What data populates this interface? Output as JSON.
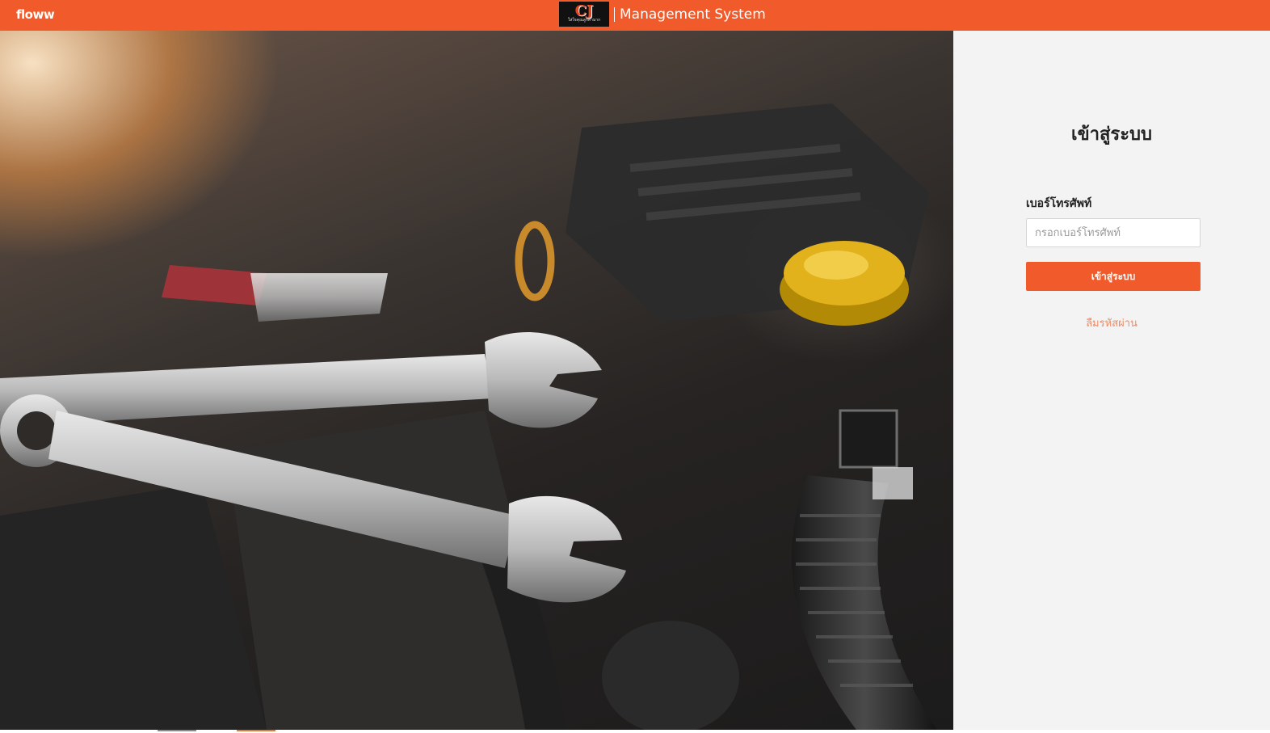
{
  "header": {
    "brand": "floww",
    "logo_text": "CJ",
    "logo_subtext": "ใส่ใจคุณลูกค้ามาก",
    "system_title": "Management System"
  },
  "hero": {
    "image_subject": "car-engine-with-wrenches"
  },
  "login": {
    "title": "เข้าสู่ระบบ",
    "phone_label": "เบอร์โทรศัพท์",
    "phone_placeholder": "กรอกเบอร์โทรศัพท์",
    "phone_value": "",
    "submit_label": "เข้าสู่ระบบ",
    "forgot_label": "ลืมรหัสผ่าน"
  },
  "colors": {
    "accent": "#f15a2a",
    "panel_bg": "#f3f3f3",
    "link": "#ef8a62"
  }
}
